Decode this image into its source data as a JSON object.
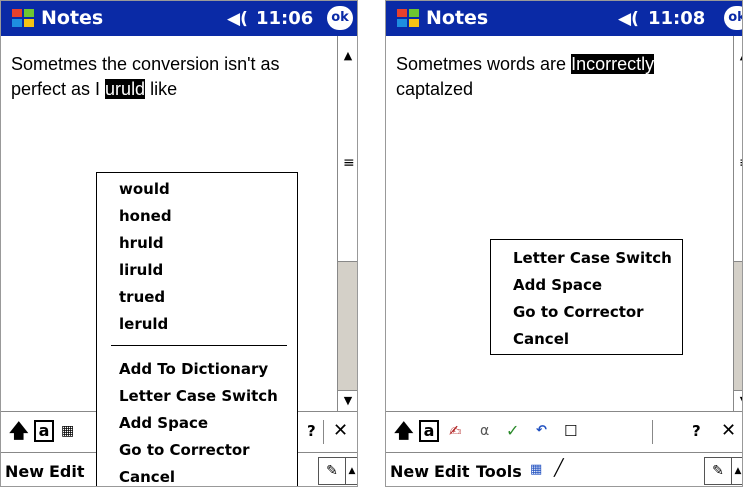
{
  "left": {
    "status": {
      "app_title": "Notes",
      "time": "11:06",
      "ok_label": "ok"
    },
    "note": {
      "line1": "Sometmes the conversion isn't as",
      "line2_pre": "perfect as I ",
      "line2_sel": "uruld",
      "line2_post": " like"
    },
    "suggestions": [
      "would",
      "honed",
      "hruld",
      "liruld",
      "trued",
      "leruld"
    ],
    "actions": [
      "Add To Dictionary",
      "Letter Case Switch",
      "Add Space",
      "Go to Corrector",
      "Cancel"
    ],
    "menubar": {
      "new": "New",
      "edit": "Edit"
    }
  },
  "right": {
    "status": {
      "app_title": "Notes",
      "time": "11:08",
      "ok_label": "ok"
    },
    "note": {
      "line1_pre": "Sometmes words are ",
      "line1_sel": "Incorrectly",
      "line2": "captalzed"
    },
    "actions": [
      "Letter Case Switch",
      "Add Space",
      "Go to Corrector",
      "Cancel"
    ],
    "menubar": {
      "new": "New",
      "edit": "Edit",
      "tools": "Tools"
    }
  },
  "icons": {
    "windows_logo": "windows-flag-icon",
    "speaker": "speaker-icon",
    "shift": "shift-arrow-icon",
    "pen": "pen-input-icon"
  },
  "colors": {
    "titlebar": "#0a2aa6",
    "scrollbar": "#d4d0c8"
  }
}
